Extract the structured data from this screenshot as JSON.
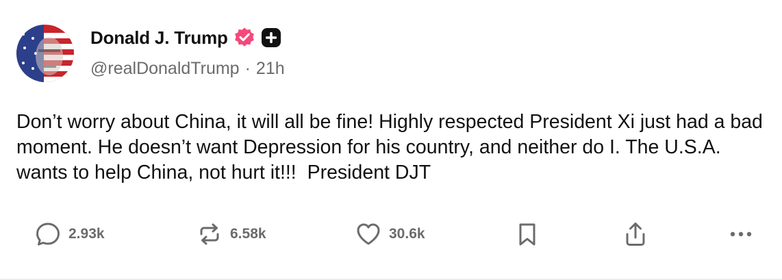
{
  "post": {
    "author_name": "Donald J. Trump",
    "handle": "@realDonaldTrump",
    "separator": "·",
    "time": "21h",
    "text": "Don’t worry about China, it will all be fine! Highly respected President Xi just had a bad moment. He doesn’t want Depression for his country, and neither do I. The U.S.A. wants to help China, not hurt it!!!  President DJT"
  },
  "actions": {
    "replies": "2.93k",
    "reposts": "6.58k",
    "likes": "30.6k"
  },
  "colors": {
    "verified_badge": "#f6477a",
    "text_primary": "#111111",
    "text_secondary": "#6b6b6b"
  },
  "icons": [
    "verified-badge-icon",
    "plus-badge-icon",
    "reply-icon",
    "repost-icon",
    "like-icon",
    "bookmark-icon",
    "share-icon",
    "more-icon"
  ]
}
